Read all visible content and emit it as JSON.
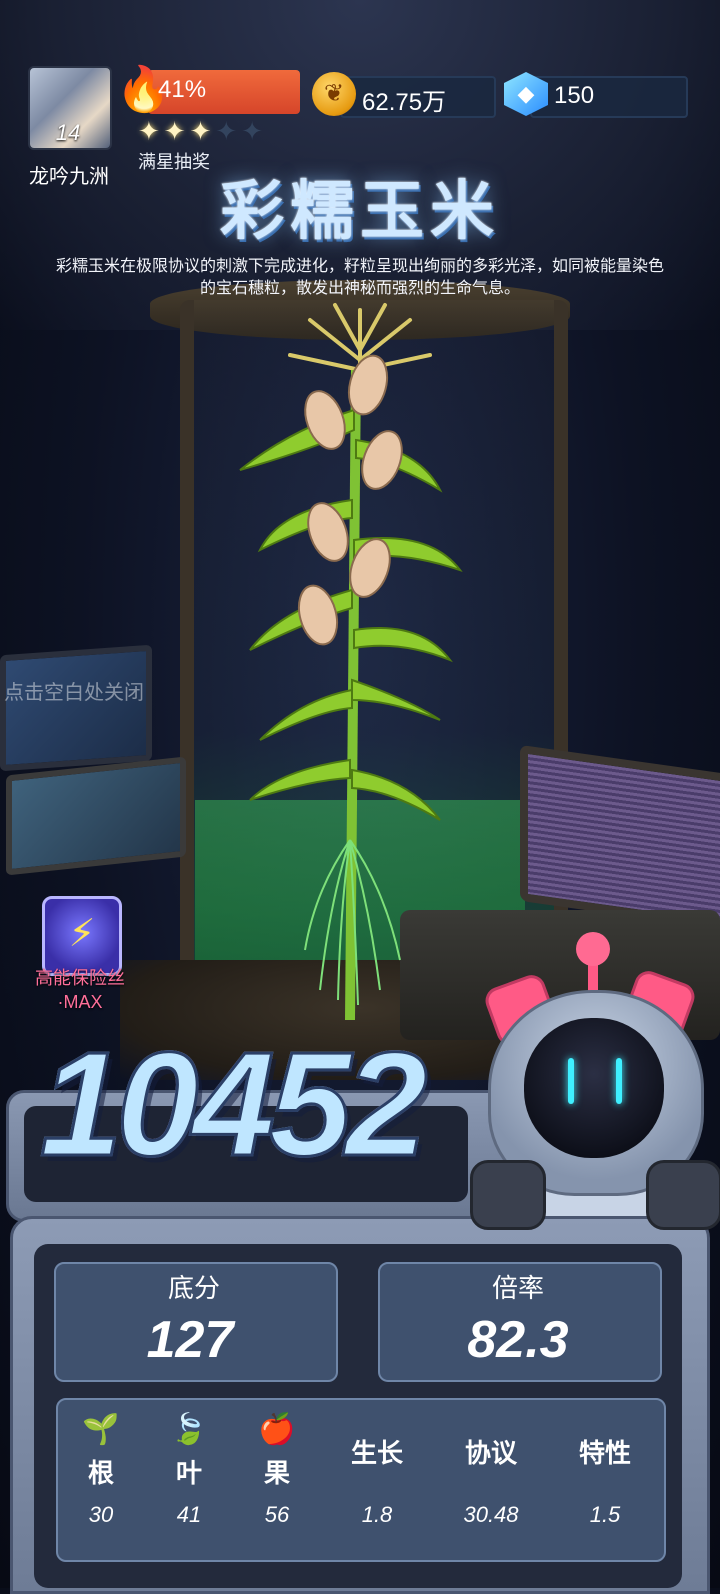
{
  "player": {
    "level": "14",
    "name": "龙吟九洲"
  },
  "fire": {
    "percent": "41%",
    "progress": 0.41
  },
  "stars": {
    "filled": 3,
    "total": 5,
    "label": "满星抽奖"
  },
  "resources": {
    "gold": "62.75万",
    "gems": "150",
    "gold_icon": "coin-sprout-icon",
    "gem_icon": "diamond-icon"
  },
  "crop": {
    "title": "彩糯玉米",
    "description": "彩糯玉米在极限协议的刺激下完成进化，籽粒呈现出绚丽的多彩光泽，如同被能量染色的宝石穗粒，散发出神秘而强烈的生命气息。"
  },
  "hint": "点击空白处关闭",
  "buff": {
    "label_line1": "高能保险丝",
    "label_line2": "·MAX",
    "badge": "MAX",
    "icon": "lightning-shield-icon"
  },
  "score": {
    "total": "10452"
  },
  "stats": {
    "base_label": "底分",
    "base_value": "127",
    "multiplier_label": "倍率",
    "multiplier_value": "82.3"
  },
  "attributes": [
    {
      "name": "根",
      "value": "30",
      "icon": "root-icon"
    },
    {
      "name": "叶",
      "value": "41",
      "icon": "leaf-icon"
    },
    {
      "name": "果",
      "value": "56",
      "icon": "apple-icon"
    },
    {
      "name": "生长",
      "value": "1.8"
    },
    {
      "name": "协议",
      "value": "30.48"
    },
    {
      "name": "特性",
      "value": "1.5"
    }
  ],
  "colors": {
    "fire_bar": "#e4553a",
    "robot_accent": "#ff5a86",
    "panel": "#3f516e"
  }
}
